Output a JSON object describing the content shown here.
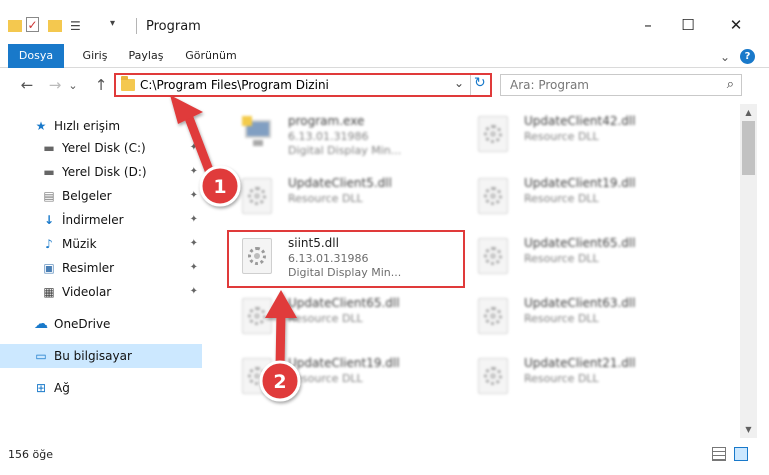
{
  "window": {
    "title": "Program",
    "minimize": "–",
    "maximize": "☐",
    "close": "✕"
  },
  "ribbon": {
    "tabs": [
      "Dosya",
      "Giriş",
      "Paylaş",
      "Görünüm"
    ],
    "expand": "⌄",
    "help": "?"
  },
  "nav": {
    "back": "←",
    "forward": "→",
    "recent": "⌄",
    "up": "↑",
    "address": "C:\\Program Files\\Program Dizini",
    "address_chevron": "⌄",
    "refresh": "↻",
    "search_placeholder": "Ara: Program",
    "search_icon": "⌕"
  },
  "sidebar": {
    "items": [
      {
        "label": "Hızlı erişim",
        "icon": "star-icon",
        "glyph": "★",
        "color": "#1979ca"
      },
      {
        "label": "Yerel Disk (C:)",
        "icon": "drive-icon",
        "glyph": "▬",
        "color": "#666666",
        "pinned": true
      },
      {
        "label": "Yerel Disk (D:)",
        "icon": "drive-icon",
        "glyph": "▬",
        "color": "#666666",
        "pinned": true
      },
      {
        "label": "Belgeler",
        "icon": "documents-icon",
        "glyph": "▤",
        "color": "#7a7a7a",
        "pinned": true
      },
      {
        "label": "İndirmeler",
        "icon": "download-icon",
        "glyph": "↓",
        "color": "#1979ca",
        "pinned": true
      },
      {
        "label": "Müzik",
        "icon": "music-icon",
        "glyph": "♪",
        "color": "#1979ca",
        "pinned": true
      },
      {
        "label": "Resimler",
        "icon": "pictures-icon",
        "glyph": "▣",
        "color": "#4a7fb5",
        "pinned": true
      },
      {
        "label": "Videolar",
        "icon": "videos-icon",
        "glyph": "▦",
        "color": "#444444",
        "pinned": true
      },
      {
        "label": "OneDrive",
        "icon": "cloud-icon",
        "glyph": "☁",
        "color": "#1979ca"
      },
      {
        "label": "Bu bilgisayar",
        "icon": "computer-icon",
        "glyph": "▭",
        "color": "#1979ca",
        "selected": true
      },
      {
        "label": "Ağ",
        "icon": "network-icon",
        "glyph": "⊞",
        "color": "#1979ca"
      }
    ],
    "pin_glyph": "📌"
  },
  "files": {
    "left": [
      {
        "name": "program.exe",
        "line2": "6.13.01.31986",
        "line3": "Digital Display Min...",
        "type": "exe"
      },
      {
        "name": "UpdateClient5.dll",
        "line2": "Resource DLL",
        "line3": "",
        "type": "dll"
      },
      {
        "name": "siint5.dll",
        "line2": "6.13.01.31986",
        "line3": "Digital Display Min...",
        "type": "dll"
      },
      {
        "name": "UpdateClient65.dll",
        "line2": "Resource DLL",
        "line3": "",
        "type": "dll"
      },
      {
        "name": "UpdateClient19.dll",
        "line2": "Resource DLL",
        "line3": "",
        "type": "dll"
      }
    ],
    "right": [
      {
        "name": "UpdateClient42.dll",
        "line2": "Resource DLL"
      },
      {
        "name": "UpdateClient19.dll",
        "line2": "Resource DLL"
      },
      {
        "name": "UpdateClient65.dll",
        "line2": "Resource DLL"
      },
      {
        "name": "UpdateClient63.dll",
        "line2": "Resource DLL"
      },
      {
        "name": "UpdateClient21.dll",
        "line2": "Resource DLL"
      }
    ]
  },
  "scrollbar": {
    "up": "▲",
    "down": "▼"
  },
  "status": {
    "count": "156 öğe"
  },
  "annotations": {
    "badge1": "1",
    "badge2": "2",
    "color": "#e03a3a"
  }
}
